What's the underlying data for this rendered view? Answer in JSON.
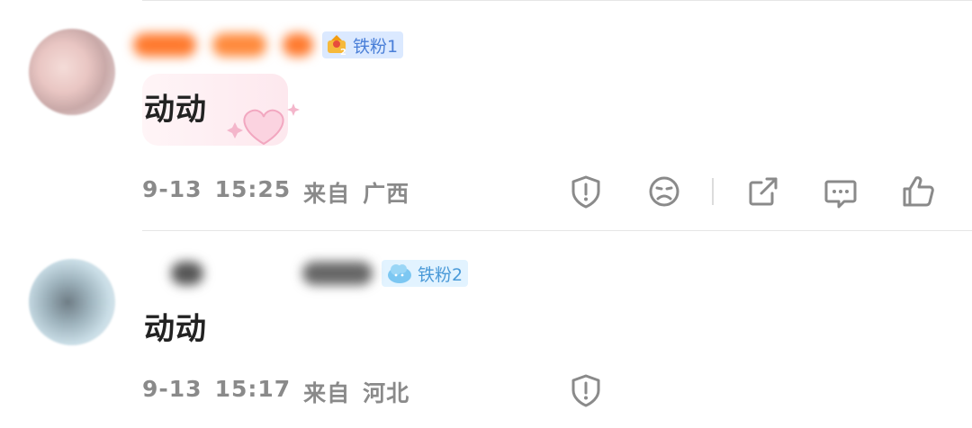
{
  "comments": [
    {
      "badge_label": "铁粉1",
      "text": "动动",
      "date": "9-13",
      "time": "15:25",
      "from_label": "来自",
      "location": "广西"
    },
    {
      "badge_label": "铁粉2",
      "text": "动动",
      "date": "9-13",
      "time": "15:17",
      "from_label": "来自",
      "location": "河北"
    }
  ],
  "icons": [
    "shield-alert-icon",
    "frown-icon",
    "share-icon",
    "comment-icon",
    "thumbs-up-icon"
  ],
  "colors": {
    "badge_blue": "#4a7fd8",
    "meta_gray": "#8a8a8a",
    "icon_gray": "#8a8a8a"
  }
}
